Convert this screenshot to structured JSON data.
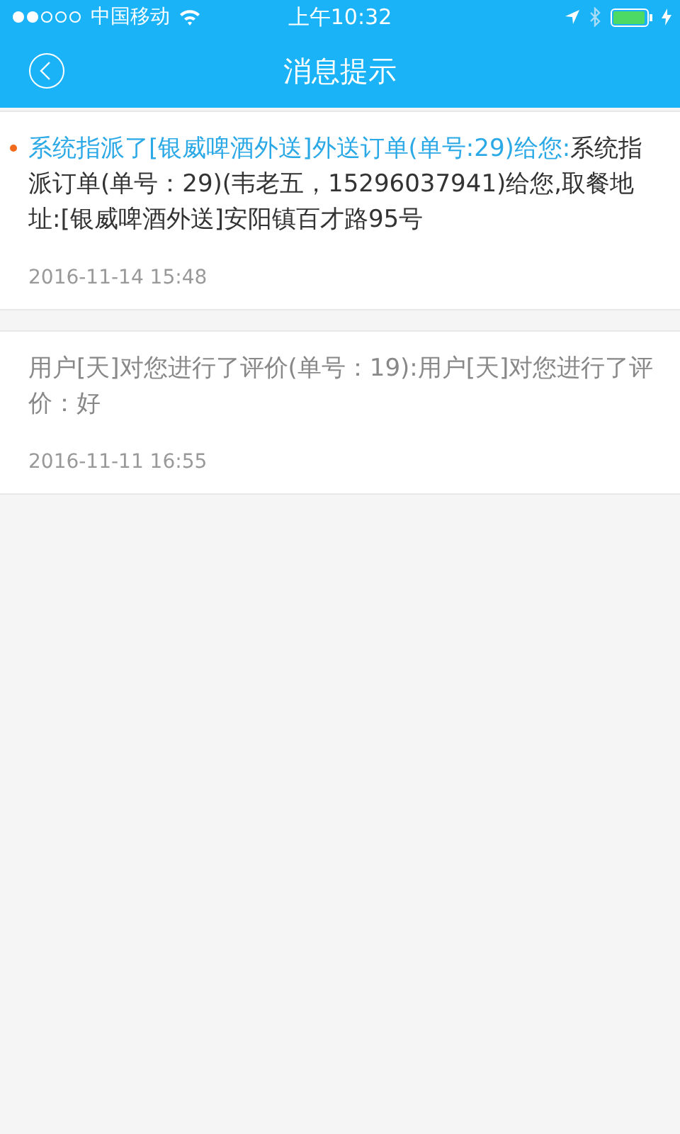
{
  "status_bar": {
    "carrier": "中国移动",
    "time": "上午10:32"
  },
  "header": {
    "title": "消息提示"
  },
  "messages": [
    {
      "unread": true,
      "title": "系统指派了[银威啤酒外送]外送订单(单号:29)给您:",
      "body": "系统指派订单(单号：29)(韦老五，15296037941)给您,取餐地址:[银威啤酒外送]安阳镇百才路95号",
      "time": "2016-11-14 15:48"
    },
    {
      "unread": false,
      "title": "用户[天]对您进行了评价(单号：19):",
      "body": "用户[天]对您进行了评价：好",
      "time": "2016-11-11 16:55"
    }
  ]
}
